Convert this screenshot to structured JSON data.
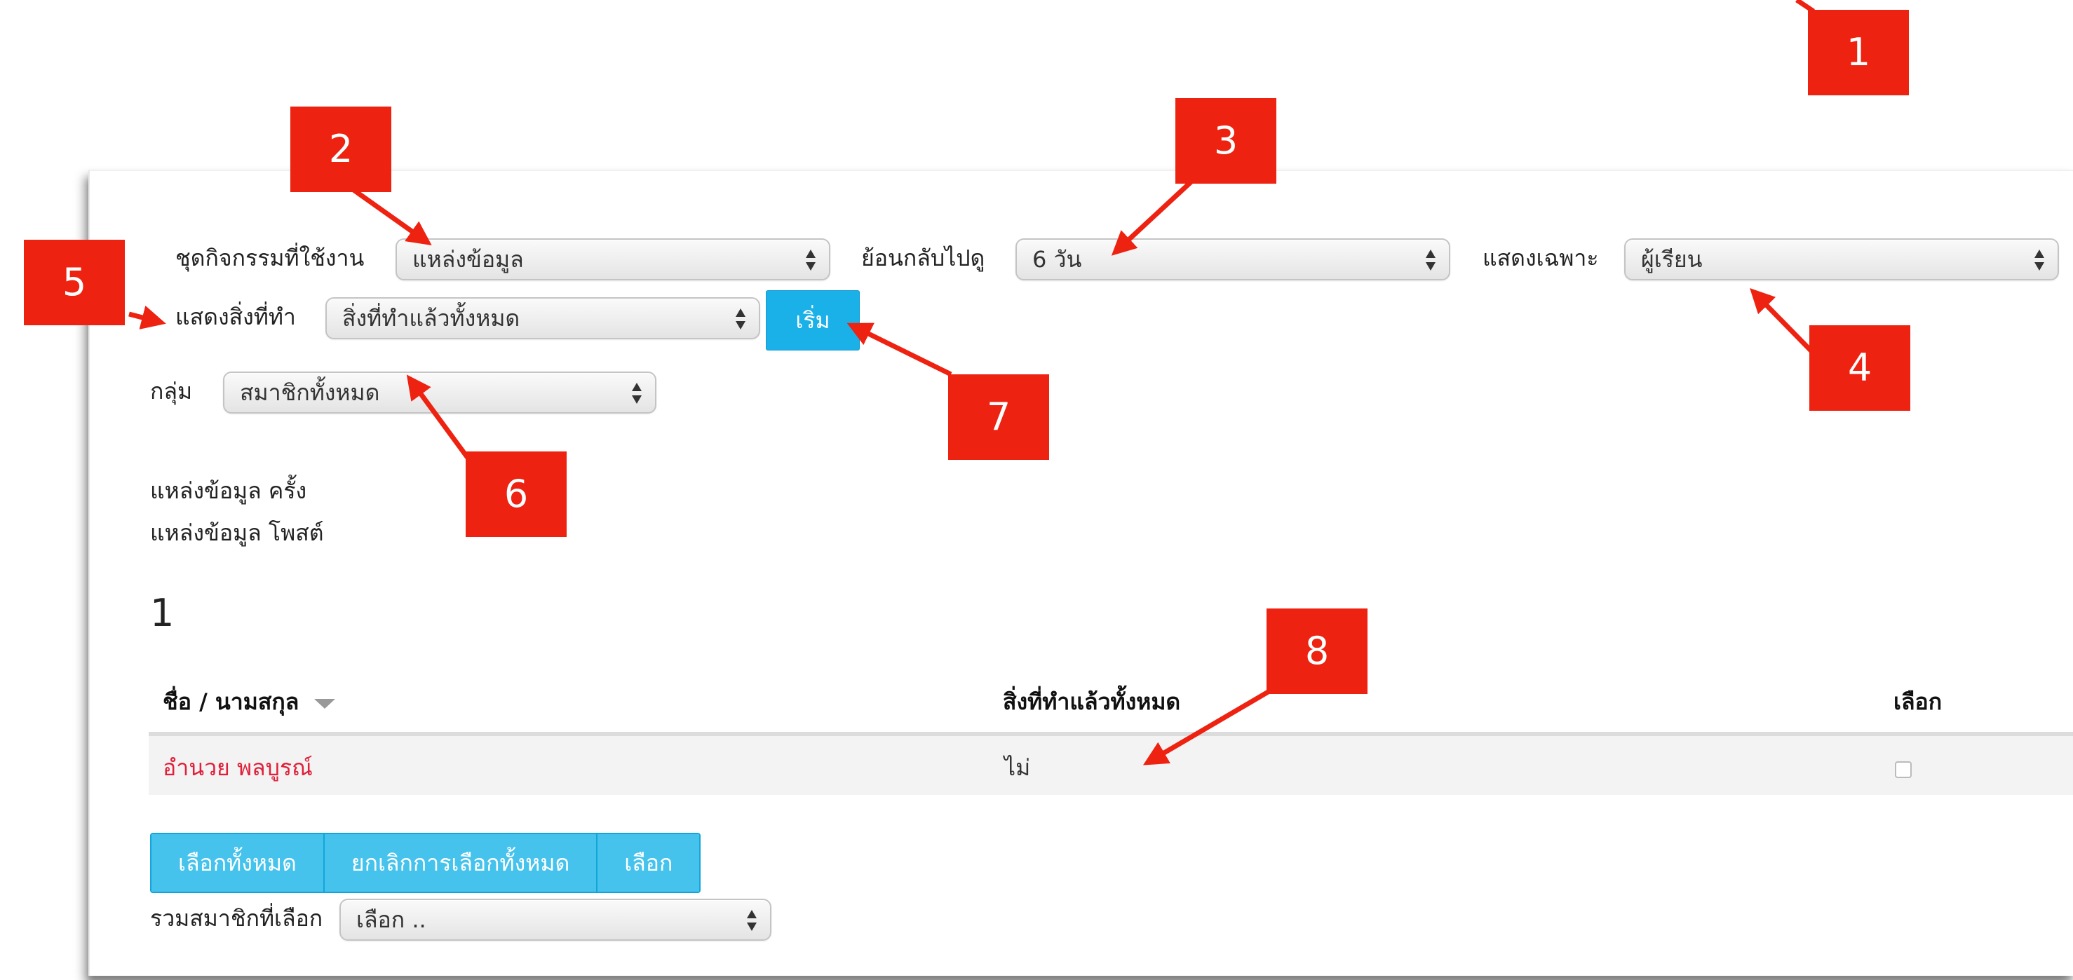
{
  "filters": {
    "activity_set_label": "ชุดกิจกรรมที่ใช้งาน",
    "activity_set_value": "แหล่งข้อมูล",
    "lookback_label": "ย้อนกลับไปดู",
    "lookback_value": "6 วัน",
    "show_only_label": "แสดงเฉพาะ",
    "show_only_value": "ผู้เรียน",
    "show_actions_label": "แสดงสิ่งที่ทำ",
    "show_actions_value": "สิ่งที่ทำแล้วทั้งหมด",
    "go_button": "เริ่ม",
    "group_label": "กลุ่ม",
    "group_value": "สมาชิกทั้งหมด"
  },
  "info": {
    "line1": "แหล่งข้อมูล ครั้ง",
    "line2": "แหล่งข้อมูล โพสต์",
    "count": "1"
  },
  "table": {
    "headers": [
      "ชื่อ / นามสกุล",
      "สิ่งที่ทำแล้วทั้งหมด",
      "เลือก"
    ],
    "rows": [
      {
        "name": "อำนวย พลบูรณ์",
        "status": "ไม่"
      }
    ]
  },
  "actions": {
    "select_all": "เลือกทั้งหมด",
    "deselect_all": "ยกเลิกการเลือกทั้งหมด",
    "select": "เลือก",
    "with_selected_label": "รวมสมาชิกที่เลือก",
    "with_selected_value": "เลือก .."
  },
  "callouts": [
    "1",
    "2",
    "3",
    "4",
    "5",
    "6",
    "7",
    "8"
  ],
  "colors": {
    "callout_red": "#ee2211",
    "button_blue": "#1ab0e8",
    "link_red": "#e0203a"
  }
}
